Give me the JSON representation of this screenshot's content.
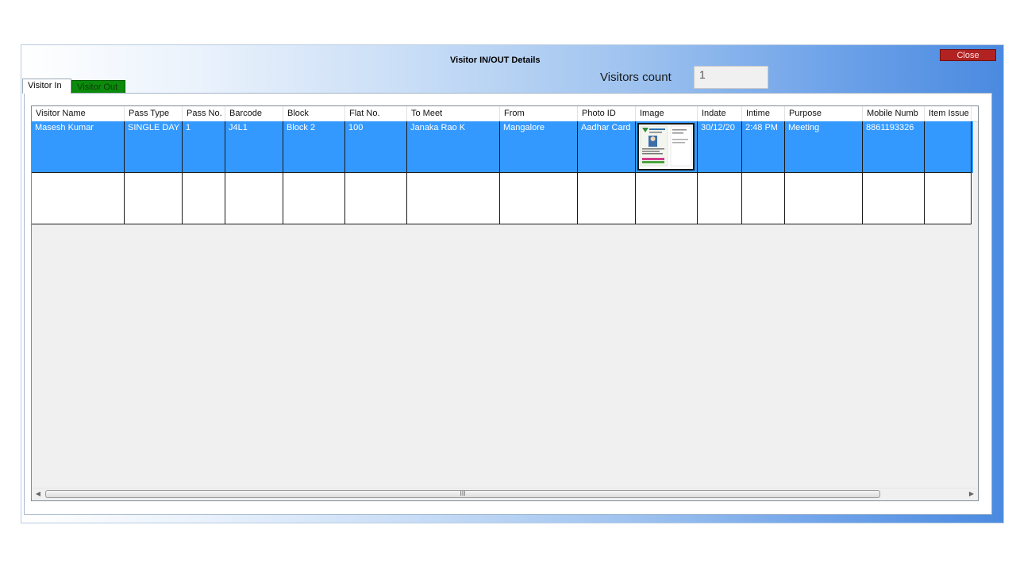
{
  "window": {
    "title": "Visitor IN/OUT Details",
    "close_label": "Close"
  },
  "visitors": {
    "count_label": "Visitors count",
    "count_value": "1"
  },
  "tabs": [
    {
      "label": "Visitor In",
      "active": true
    },
    {
      "label": "Visitor Out",
      "active": false
    }
  ],
  "grid": {
    "columns": [
      "Visitor Name",
      "Pass Type",
      "Pass No.",
      "Barcode",
      "Block",
      "Flat No.",
      "To Meet",
      "From",
      "Photo ID",
      "Image",
      "Indate",
      "Intime",
      "Purpose",
      "Mobile Numb",
      "Item Issue"
    ],
    "rows": [
      {
        "visitor_name": "Masesh Kumar",
        "pass_type": "SINGLE DAY",
        "pass_no": "1",
        "barcode": "J4L1",
        "block": "Block 2",
        "flat_no": "100",
        "to_meet": "Janaka Rao K",
        "from": "Mangalore",
        "photo_id": "Aadhar Card",
        "image": "id-card-thumbnail",
        "indate": "30/12/20",
        "intime": "2:48 PM",
        "purpose": "Meeting",
        "mobile": "8861193326",
        "item_issue": ""
      }
    ],
    "scroll_grip": "III"
  },
  "colors": {
    "selected_row": "#3399ff",
    "close_button": "#b22222",
    "visitor_out_tab": "#0b8a0b"
  },
  "icons": {
    "scroll_left": "scroll-left-arrow-icon",
    "scroll_right": "scroll-right-arrow-icon"
  }
}
